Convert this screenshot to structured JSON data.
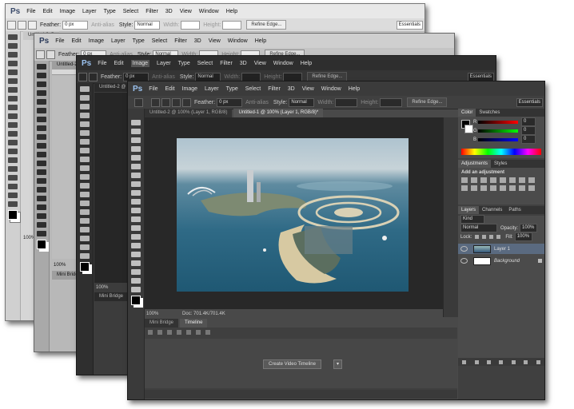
{
  "app": {
    "logo": "Ps"
  },
  "menu": [
    "File",
    "Edit",
    "Image",
    "Layer",
    "Type",
    "Select",
    "Filter",
    "3D",
    "View",
    "Window",
    "Help"
  ],
  "options": {
    "feather_label": "Feather:",
    "feather_value": "0 px",
    "anti_alias": "Anti-alias",
    "style_label": "Style:",
    "style_value": "Normal",
    "width_label": "Width:",
    "height_label": "Height:",
    "refine_edge": "Refine Edge...",
    "workspace": "Essentials"
  },
  "documents": {
    "tab_untitled2": "Untitled-2 @ 100% (Layer 1, RGB/8)",
    "tab_untitled2_short": "Untitled-2 @",
    "tab_untitled1": "Untitled-1 @ 100% (Layer 1, RGB/8)*"
  },
  "status": {
    "zoom": "100%",
    "doc": "Doc: 701.4K/701.4K"
  },
  "bottom_tabs": {
    "mini_bridge": "Mini Bridge",
    "timeline": "Timeline"
  },
  "timeline": {
    "create_button": "Create Video Timeline"
  },
  "color_panel": {
    "tabs": [
      "Color",
      "Swatches"
    ],
    "channels": [
      {
        "label": "R",
        "value": "0"
      },
      {
        "label": "G",
        "value": "0"
      },
      {
        "label": "B",
        "value": "0"
      }
    ]
  },
  "adjustments_panel": {
    "tabs": [
      "Adjustments",
      "Styles"
    ],
    "heading": "Add an adjustment"
  },
  "layers_panel": {
    "tabs": [
      "Layers",
      "Channels",
      "Paths"
    ],
    "filter_kind": "Kind",
    "blend_mode": "Normal",
    "opacity_label": "Opacity:",
    "opacity_value": "100%",
    "lock_label": "Lock:",
    "fill_label": "Fill:",
    "fill_value": "100%",
    "layers": [
      {
        "name": "Layer 1",
        "selected": true
      },
      {
        "name": "Background",
        "selected": false
      }
    ]
  },
  "colors": {
    "accent": "#9bc2ef",
    "selected_layer": "#5a6a80"
  }
}
